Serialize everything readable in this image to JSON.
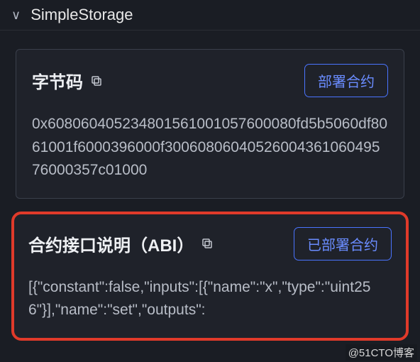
{
  "header": {
    "title": "SimpleStorage"
  },
  "bytecode": {
    "label": "字节码",
    "deploy_button": "部署合约",
    "content": "0x608060405234801561001057600080fd5b5060df8061001f6000396000f3006080604052600436106049576000357c01000"
  },
  "abi": {
    "label": "合约接口说明（ABI）",
    "deployed_button": "已部署合约",
    "content": "[{\"constant\":false,\"inputs\":[{\"name\":\"x\",\"type\":\"uint256\"}],\"name\":\"set\",\"outputs\":"
  },
  "watermark": "@51CTO博客"
}
